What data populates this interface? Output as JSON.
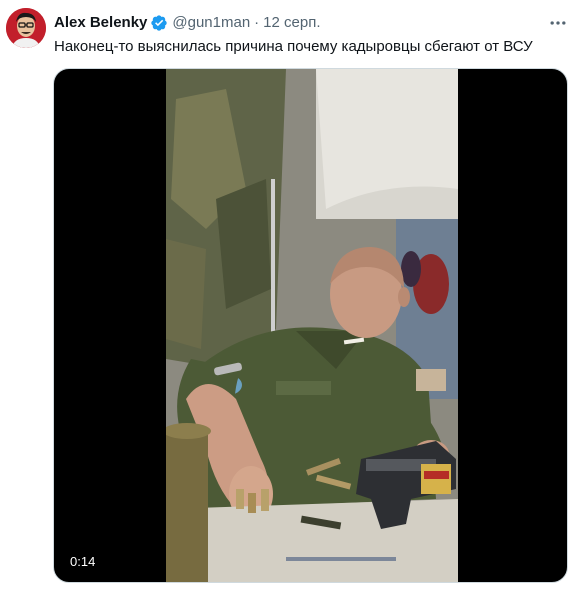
{
  "tweet": {
    "author_name": "Alex Belenky",
    "handle": "@gun1man",
    "separator": "·",
    "date": "12 серп.",
    "text": "Наконец-то выяснилась причина почему кадыровцы сбегают от ВСУ",
    "verified": true
  },
  "video": {
    "duration": "0:14"
  },
  "icons": {
    "avatar": "avatar-portrait-icon",
    "verified": "verified-badge-icon",
    "more": "more-options-icon"
  },
  "colors": {
    "verified_blue": "#1d9bf0",
    "secondary_text": "#536471",
    "primary_text": "#0f1419",
    "media_border": "#cfd9de"
  }
}
